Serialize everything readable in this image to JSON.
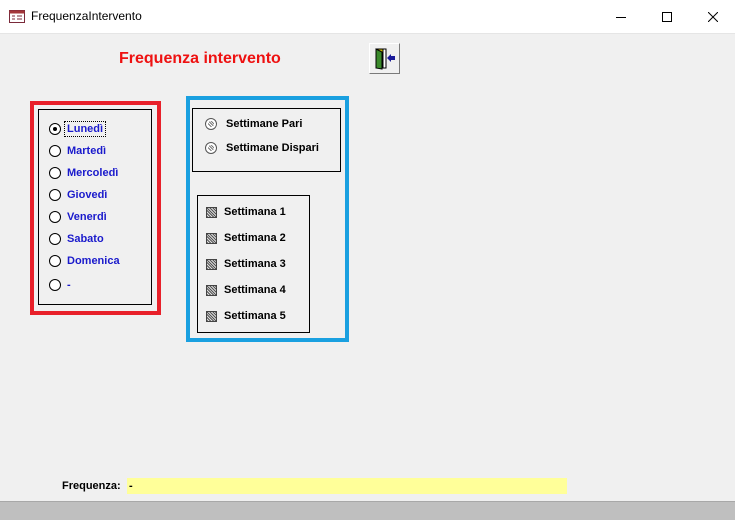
{
  "window": {
    "title": "FrequenzaIntervento",
    "icon": "form-icon",
    "controls": [
      "minimize-icon",
      "maximize-icon",
      "close-icon"
    ]
  },
  "form": {
    "title": "Frequenza intervento",
    "title_color": "#ee1111",
    "exit_icon": "exit-door-icon"
  },
  "days": {
    "selected": "Lunedì",
    "label_color": "#1a1acc",
    "frame_color": "#e8202a",
    "options": [
      {
        "label": "Lunedì",
        "checked": true
      },
      {
        "label": "Martedì",
        "checked": false
      },
      {
        "label": "Mercoledì",
        "checked": false
      },
      {
        "label": "Giovedì",
        "checked": false
      },
      {
        "label": "Venerdì",
        "checked": false
      },
      {
        "label": "Sabato",
        "checked": false
      },
      {
        "label": "Domenica",
        "checked": false
      },
      {
        "label": "-",
        "checked": false
      }
    ]
  },
  "weeks": {
    "frame_color": "#1aa0e0",
    "parity_options": [
      {
        "label": "Settimane Pari"
      },
      {
        "label": "Settimane Dispari"
      }
    ],
    "week_options": [
      {
        "label": "Settimana 1"
      },
      {
        "label": "Settimana 2"
      },
      {
        "label": "Settimana 3"
      },
      {
        "label": "Settimana 4"
      },
      {
        "label": "Settimana 5"
      }
    ]
  },
  "frequenza": {
    "label": "Frequenza:",
    "value": "-",
    "field_color": "#ffff99"
  }
}
